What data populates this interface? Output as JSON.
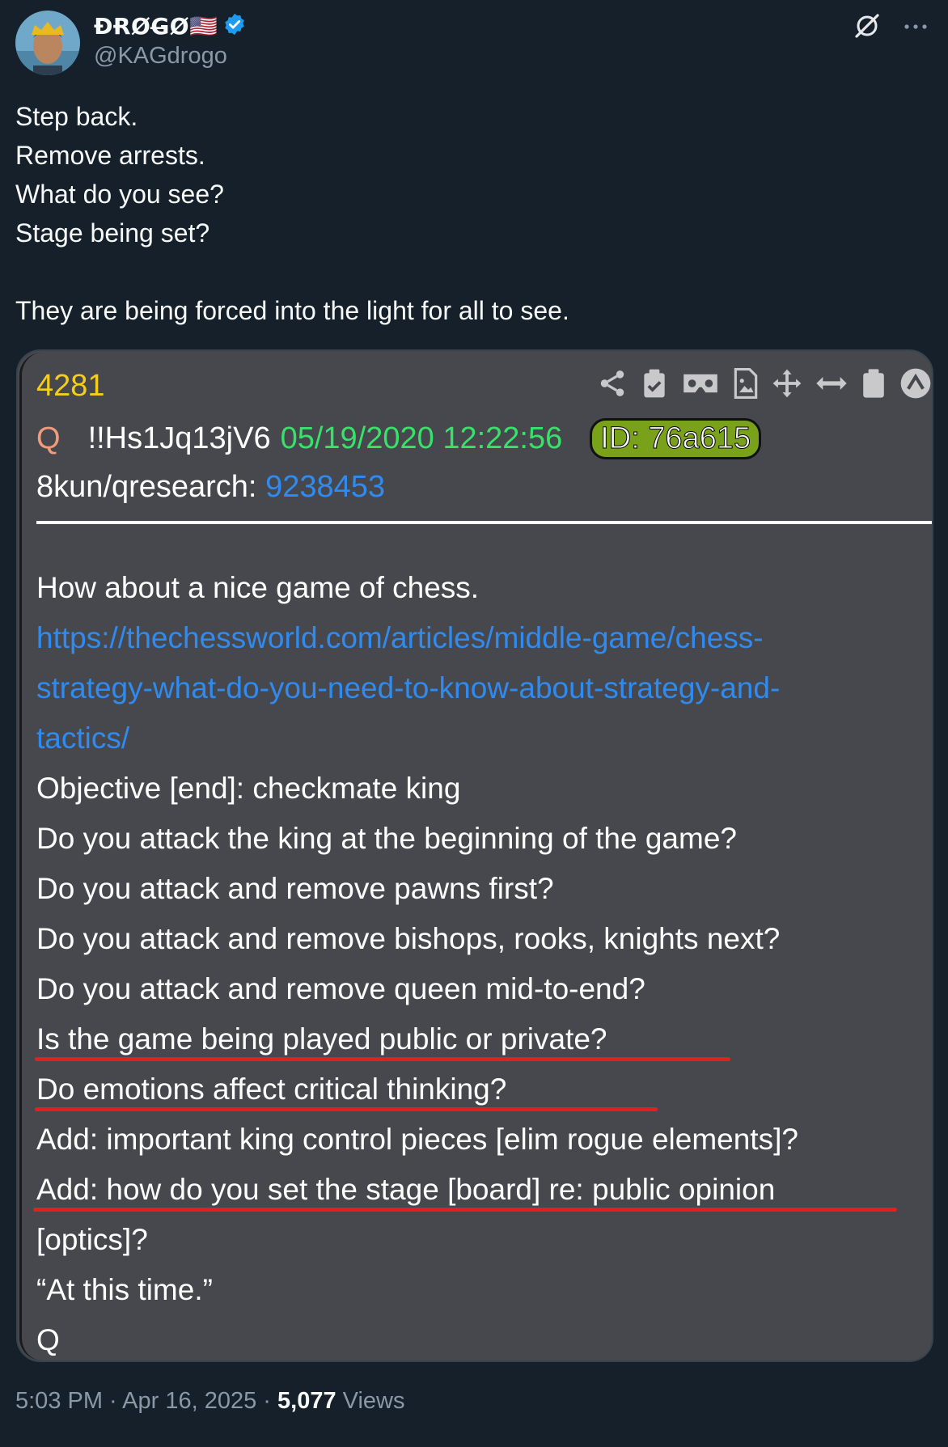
{
  "author": {
    "display_name": "ÐɌØG̶Ø🇺🇸",
    "handle": "@KAGdrogo",
    "verified_icon": "verified-badge-icon"
  },
  "header_actions": {
    "grok_icon": "grok-icon",
    "more_icon": "more-options-icon"
  },
  "tweet": {
    "lines": [
      "Step back.",
      "Remove arrests.",
      "What do you see?",
      "Stage being set?",
      "",
      "They are being forced into the light for all to see."
    ]
  },
  "card": {
    "post_number": "4281",
    "q_label": "Q",
    "tripcode": "!!Hs1Jq13jV6",
    "datetime": "05/19/2020 12:22:56",
    "id_label": "ID: 76a615",
    "board_label": "8kun/qresearch: ",
    "board_post": "9238453",
    "body": [
      "How about a nice game of chess.",
      "https://thechessworld.com/articles/middle-game/chess-",
      "strategy-what-do-you-need-to-know-about-strategy-and-",
      "tactics/",
      "Objective [end]: checkmate king",
      "Do you attack the king at the beginning of the game?",
      "Do you attack and remove pawns first?",
      "Do you attack and remove bishops, rooks, knights next?",
      "Do you attack and remove queen mid-to-end?",
      "Is the game being played public or private?",
      "Do emotions affect critical thinking?",
      "Add: important king control pieces [elim rogue elements]?",
      "Add: how do you set the stage [board] re: public opinion",
      "[optics]?",
      " “At this time.”",
      "Q"
    ],
    "colors": {
      "number": "#f5cd1d",
      "date": "#39e06a",
      "link": "#2f8bf0",
      "underline": "#e0221f",
      "id_bg": "#7aa11a"
    }
  },
  "footer": {
    "time": "5:03 PM",
    "sep1": " · ",
    "date": "Apr 16, 2025",
    "sep2": " · ",
    "views_count": "5,077",
    "views_label": " Views"
  }
}
